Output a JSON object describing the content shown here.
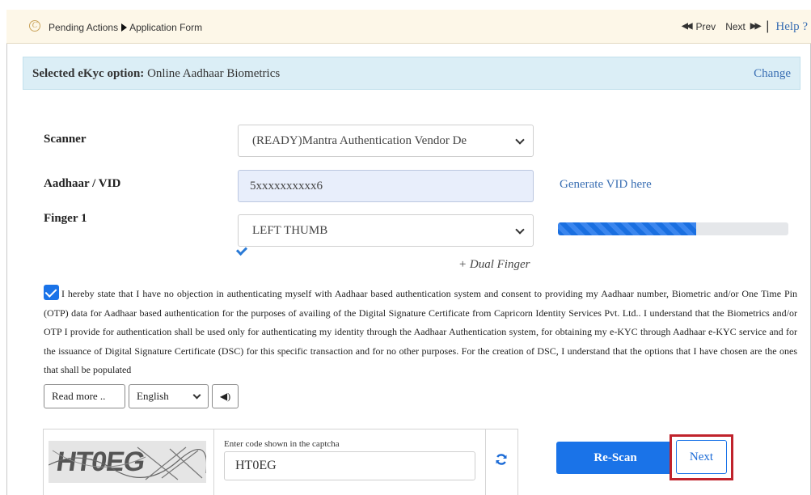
{
  "header": {
    "breadcrumb_root": "Pending Actions",
    "breadcrumb_page": "Application Form",
    "prev_label": "Prev",
    "next_label": "Next",
    "help_label": "Help ?"
  },
  "ekyc": {
    "label": "Selected eKyc option:",
    "value": "Online Aadhaar Biometrics",
    "change_label": "Change"
  },
  "form": {
    "scanner_label": "Scanner",
    "scanner_value": "(READY)Mantra Authentication Vendor De",
    "aadhaar_label": "Aadhaar / VID",
    "aadhaar_value": "5xxxxxxxxxx6",
    "generate_vid_label": "Generate VID here",
    "finger_label": "Finger 1",
    "finger_value": "LEFT THUMB",
    "scan_progress": 0.6,
    "dual_finger_label": "+ Dual Finger"
  },
  "consent": {
    "checked": true,
    "text": "I hereby state that I have no objection in authenticating myself with Aadhaar based authentication system and consent to providing my Aadhaar number, Biometric and/or One Time Pin (OTP) data for Aadhaar based authentication for the purposes of availing of the Digital Signature Certificate from Capricorn Identity Services Pvt. Ltd.. I understand that the Biometrics and/or OTP I provide for authentication shall be used only for authenticating my identity through the Aadhaar Authentication system, for obtaining my e-KYC through Aadhaar e-KYC service and for the issuance of Digital Signature Certificate (DSC) for this specific transaction and for no other purposes. For the creation of DSC, I understand that the options that I have chosen are the ones that shall be populated",
    "read_more_label": "Read more ..",
    "language_value": "English"
  },
  "captcha": {
    "image_text": "HT0EG",
    "input_label": "Enter code shown in the captcha",
    "input_value": "HT0EG"
  },
  "actions": {
    "rescan_label": "Re-Scan",
    "next_label": "Next"
  },
  "colors": {
    "primary": "#1a73e8",
    "link": "#3a6fb3",
    "header_bg": "#fdf7e8",
    "ekyc_bg": "#dbeef6",
    "highlight": "#c0232c"
  },
  "icons": [
    "logo-icon",
    "arrow-right-icon",
    "double-left-icon",
    "double-right-icon",
    "chevron-down-icon",
    "check-icon",
    "speaker-icon",
    "refresh-icon"
  ]
}
